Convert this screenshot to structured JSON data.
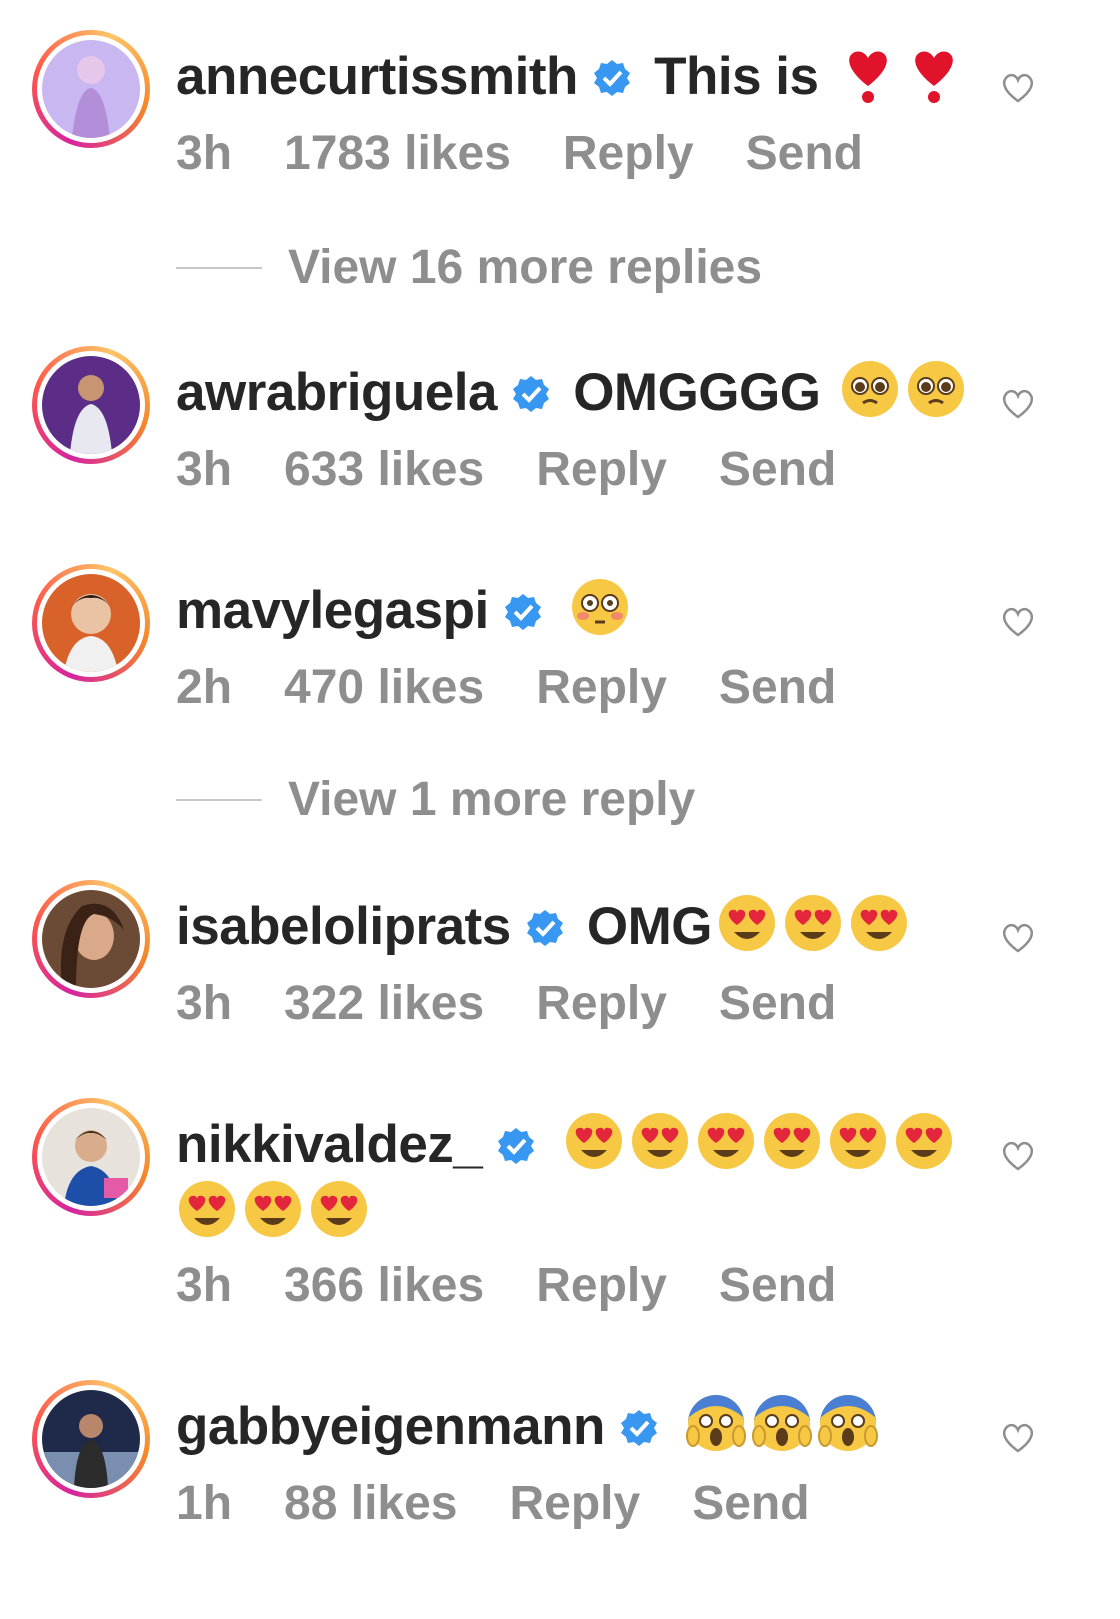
{
  "comments": [
    {
      "username": "annecurtissmith",
      "text": "This is",
      "emoji": "❣️❣️",
      "time": "3h",
      "likes": "1783 likes",
      "reply": "Reply",
      "send": "Send",
      "view_more": "View 16 more replies"
    },
    {
      "username": "awrabriguela",
      "text": "OMGGGG",
      "emoji": "🥺🥺",
      "time": "3h",
      "likes": "633 likes",
      "reply": "Reply",
      "send": "Send"
    },
    {
      "username": "mavylegaspi",
      "text": "",
      "emoji": "😳",
      "time": "2h",
      "likes": "470 likes",
      "reply": "Reply",
      "send": "Send",
      "view_more": "View 1 more reply"
    },
    {
      "username": "isabeloliprats",
      "text": "OMG",
      "emoji": "😍😍😍",
      "time": "3h",
      "likes": "322 likes",
      "reply": "Reply",
      "send": "Send"
    },
    {
      "username": "nikkivaldez_",
      "text": "",
      "emoji": "😍😍😍😍😍😍😍😍😍",
      "time": "3h",
      "likes": "366 likes",
      "reply": "Reply",
      "send": "Send"
    },
    {
      "username": "gabbyeigenmann",
      "text": "",
      "emoji": "😱😱😱",
      "time": "1h",
      "likes": "88 likes",
      "reply": "Reply",
      "send": "Send"
    }
  ],
  "icons": {
    "verified": "verified-badge-icon",
    "like": "heart-outline-icon"
  },
  "colors": {
    "verified_blue": "#3897f0",
    "meta_gray": "#8e8e8e",
    "text_dark": "#262626"
  }
}
